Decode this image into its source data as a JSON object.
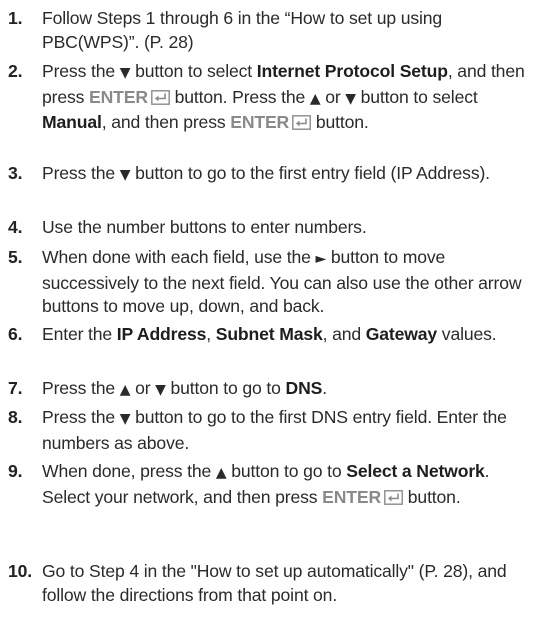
{
  "steps": [
    {
      "number": "1.",
      "parts": [
        {
          "text": "Follow Steps 1 through 6 in the “How to set up using PBC(WPS)”. (P. 28)"
        }
      ]
    },
    {
      "number": "2.",
      "parts": [
        {
          "text": "Press the "
        },
        {
          "text": "▼",
          "style": "glyph"
        },
        {
          "text": " button to select "
        },
        {
          "text": "Internet Protocol Setup",
          "style": "bold"
        },
        {
          "text": ", and then press "
        },
        {
          "text": "ENTER",
          "style": "enter"
        },
        {
          "icon": "enter-icon"
        },
        {
          "text": " button. Press the "
        },
        {
          "text": "▲",
          "style": "glyph"
        },
        {
          "text": " or "
        },
        {
          "text": "▼",
          "style": "glyph"
        },
        {
          "text": " button to select "
        },
        {
          "text": "Manual",
          "style": "bold"
        },
        {
          "text": ", and then press "
        },
        {
          "text": "ENTER",
          "style": "enter"
        },
        {
          "icon": "enter-icon"
        },
        {
          "text": " button."
        }
      ]
    },
    {
      "number": "3.",
      "parts": [
        {
          "text": "Press the "
        },
        {
          "text": "▼",
          "style": "glyph"
        },
        {
          "text": " button to go to the first entry field (IP Address)."
        }
      ]
    },
    {
      "number": "4.",
      "parts": [
        {
          "text": "Use the number buttons to enter numbers."
        }
      ]
    },
    {
      "number": "5.",
      "parts": [
        {
          "text": "When done with each field, use the "
        },
        {
          "text": "►",
          "style": "glyph"
        },
        {
          "text": " button to move successively to the next field. You can also use the other arrow buttons to move up, down, and back."
        }
      ]
    },
    {
      "number": "6.",
      "parts": [
        {
          "text": "Enter the "
        },
        {
          "text": "IP Address",
          "style": "bold"
        },
        {
          "text": ", "
        },
        {
          "text": "Subnet Mask",
          "style": "bold"
        },
        {
          "text": ", and "
        },
        {
          "text": "Gateway",
          "style": "bold"
        },
        {
          "text": " values."
        }
      ]
    },
    {
      "number": "7.",
      "parts": [
        {
          "text": "Press the "
        },
        {
          "text": "▲",
          "style": "glyph"
        },
        {
          "text": " or "
        },
        {
          "text": "▼",
          "style": "glyph"
        },
        {
          "text": " button to go to "
        },
        {
          "text": "DNS",
          "style": "bold"
        },
        {
          "text": "."
        }
      ]
    },
    {
      "number": "8.",
      "parts": [
        {
          "text": "Press the "
        },
        {
          "text": "▼",
          "style": "glyph"
        },
        {
          "text": " button to go to the first DNS entry field. Enter the numbers as above."
        }
      ]
    },
    {
      "number": "9.",
      "parts": [
        {
          "text": "When done, press the "
        },
        {
          "text": "▲",
          "style": "glyph"
        },
        {
          "text": " button to go to "
        },
        {
          "text": "Select a Network",
          "style": "bold"
        },
        {
          "text": ". Select your network, and then press "
        },
        {
          "text": "ENTER",
          "style": "enter"
        },
        {
          "icon": "enter-icon"
        },
        {
          "text": " button."
        }
      ]
    },
    {
      "number": "10.",
      "parts": [
        {
          "text": "Go to Step 4 in the \"How to set up automatically\" (P. 28), and follow the directions from that point on."
        }
      ]
    }
  ]
}
